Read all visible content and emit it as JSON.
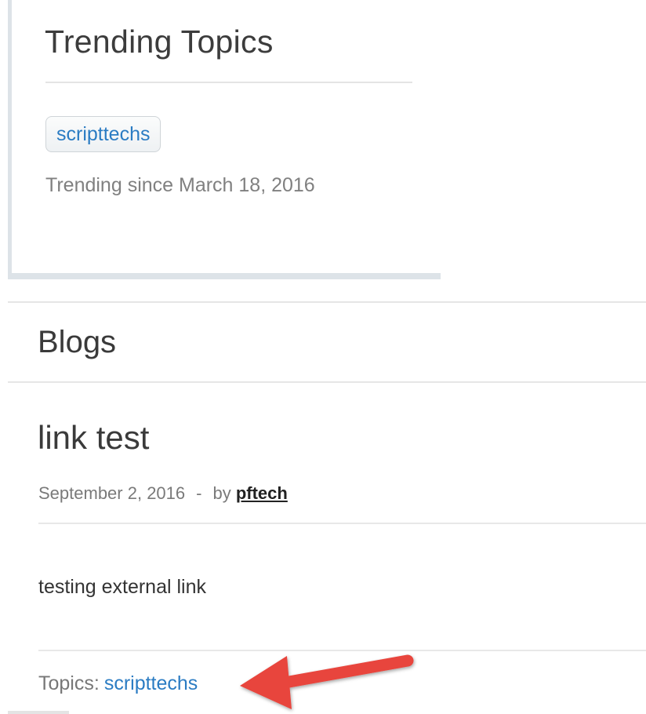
{
  "trending": {
    "title": "Trending Topics",
    "topic_tag": "scripttechs",
    "since_text": "Trending since March 18, 2016"
  },
  "blogs": {
    "heading": "Blogs",
    "post": {
      "title": "link test",
      "date": "September 2, 2016",
      "separator": "-",
      "by_label": "by",
      "author": "pftech",
      "body": "testing external link",
      "topics_label": "Topics:",
      "topic_link": "scripttechs"
    }
  },
  "colors": {
    "link": "#2b7cc3",
    "annotation_arrow": "#e8453c",
    "panel_border": "#dde3e8"
  },
  "annotation": {
    "icon": "red-arrow-icon",
    "points_to": "post-topic-link"
  }
}
